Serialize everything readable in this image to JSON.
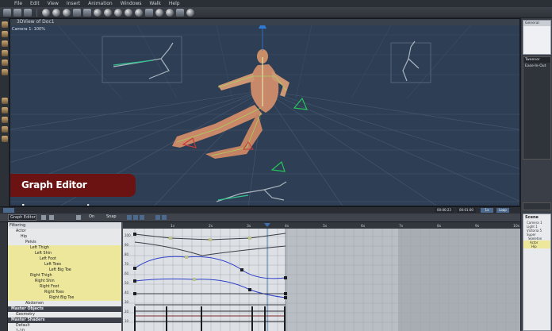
{
  "menu": [
    "File",
    "Edit",
    "View",
    "Insert",
    "Animation",
    "Windows",
    "Walk",
    "Help"
  ],
  "viewport": {
    "title": "3DView of Doc1",
    "camera_label": "Camera 1: 100%",
    "scene_bg": "#2e3e54"
  },
  "banner": {
    "text": "Graph Editor Improvements",
    "color": "#6b1212"
  },
  "right_panel": {
    "top_tab": "General",
    "tween_label": "Tweener",
    "ease_label": "Ease-In-Out",
    "scene_header": "Scene",
    "scene_items": [
      "Camera 1",
      "Light 1",
      "Victoria 5 Super",
      "Skeleton",
      "Actor",
      "Hip"
    ]
  },
  "timebar": {
    "time1": "00:00:23",
    "time2": "00:01:00",
    "zoom": "1x",
    "fps": "Loop"
  },
  "graph_editor": {
    "dropdown": "Graph Editor",
    "onion_label": "On",
    "snap_label": "Snap",
    "filter_label": "Filtering",
    "ruler_ticks": [
      "1s",
      "2s",
      "3s",
      "4s",
      "5s",
      "6s",
      "7s",
      "8s",
      "9s",
      "10s"
    ],
    "y_ticks": [
      "100",
      "90",
      "80",
      "70",
      "60",
      "50",
      "40",
      "30",
      "20",
      "10"
    ]
  },
  "tree": [
    {
      "label": "Actor",
      "indent": 1,
      "style": "plain"
    },
    {
      "label": "Hip",
      "indent": 2,
      "style": "plain"
    },
    {
      "label": "Pelvis",
      "indent": 3,
      "style": "plain"
    },
    {
      "label": "Left Thigh",
      "indent": 4,
      "style": "yellow"
    },
    {
      "label": "Left Shin",
      "indent": 5,
      "style": "yellow"
    },
    {
      "label": "Left Foot",
      "indent": 6,
      "style": "yellow"
    },
    {
      "label": "Left Toes",
      "indent": 7,
      "style": "yellow"
    },
    {
      "label": "Left Big Toe",
      "indent": 8,
      "style": "yellow"
    },
    {
      "label": "Right Thigh",
      "indent": 4,
      "style": "yellow"
    },
    {
      "label": "Right Shin",
      "indent": 5,
      "style": "yellow"
    },
    {
      "label": "Right Foot",
      "indent": 6,
      "style": "yellow"
    },
    {
      "label": "Right Toes",
      "indent": 7,
      "style": "yellow"
    },
    {
      "label": "Right Big Toe",
      "indent": 8,
      "style": "yellow"
    },
    {
      "label": "Abdomen",
      "indent": 3,
      "style": "plain"
    },
    {
      "label": "Master Objects",
      "indent": 0,
      "style": "dark"
    },
    {
      "label": "Geometry",
      "indent": 1,
      "style": "plain"
    },
    {
      "label": "Master Shaders",
      "indent": 0,
      "style": "dark"
    },
    {
      "label": "Default",
      "indent": 1,
      "style": "plain"
    },
    {
      "label": "1-10",
      "indent": 1,
      "style": "plain"
    }
  ]
}
